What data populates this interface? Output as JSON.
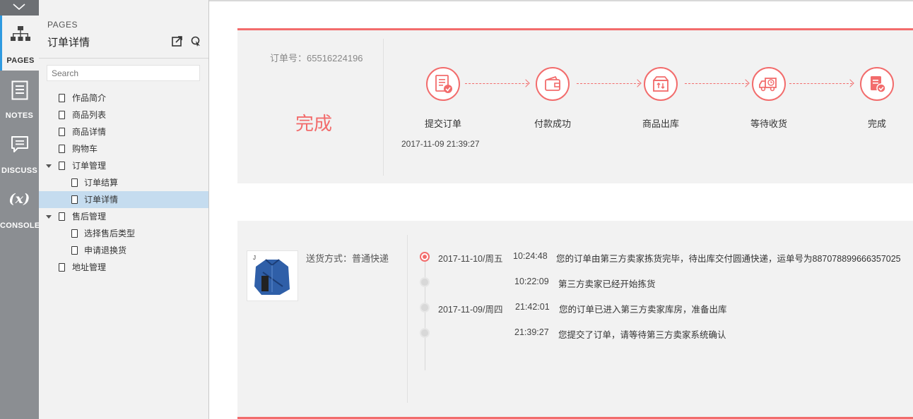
{
  "rail": {
    "items": [
      {
        "label": "PAGES",
        "icon": "sitemap-icon"
      },
      {
        "label": "NOTES",
        "icon": "notes-icon"
      },
      {
        "label": "DISCUSS",
        "icon": "discuss-icon"
      },
      {
        "label": "CONSOLE",
        "icon": "console-icon",
        "glyph": "(x)"
      }
    ]
  },
  "pages": {
    "header_sub": "PAGES",
    "header_title": "订单详情",
    "search_placeholder": "Search",
    "tree": [
      {
        "label": "作品简介"
      },
      {
        "label": "商品列表"
      },
      {
        "label": "商品详情"
      },
      {
        "label": "购物车"
      },
      {
        "label": "订单管理"
      },
      {
        "label": "订单结算"
      },
      {
        "label": "订单详情"
      },
      {
        "label": "售后管理"
      },
      {
        "label": "选择售后类型"
      },
      {
        "label": "申请退换货"
      },
      {
        "label": "地址管理"
      }
    ]
  },
  "order": {
    "number_label": "订单号：65516224196",
    "status": "完成",
    "steps": [
      {
        "label": "提交订单",
        "icon": "order-form-icon"
      },
      {
        "label": "付款成功",
        "icon": "wallet-icon"
      },
      {
        "label": "商品出库",
        "icon": "box-icon"
      },
      {
        "label": "等待收货",
        "icon": "delivery-truck-icon"
      },
      {
        "label": "完成",
        "icon": "complete-icon"
      }
    ],
    "step1_time": "2017-11-09 21:39:27"
  },
  "shipping": {
    "method": "送货方式：普通快递",
    "timeline": [
      {
        "date": "2017-11-10/周五",
        "time": "10:24:48",
        "message": "您的订单由第三方卖家拣货完毕，待出库交付圆通快递，运单号为887078899666357025"
      },
      {
        "date": "",
        "time": "10:22:09",
        "message": "第三方卖家已经开始拣货"
      },
      {
        "date": "2017-11-09/周四",
        "time": "21:42:01",
        "message": "您的订单已进入第三方卖家库房，准备出库"
      },
      {
        "date": "",
        "time": "21:39:27",
        "message": "您提交了订单，请等待第三方卖家系统确认"
      }
    ]
  },
  "colors": {
    "accent": "#f26c6c",
    "rail": "#8b8e92",
    "selected": "#c5dcef",
    "active_tab": "#2f9ae0"
  }
}
